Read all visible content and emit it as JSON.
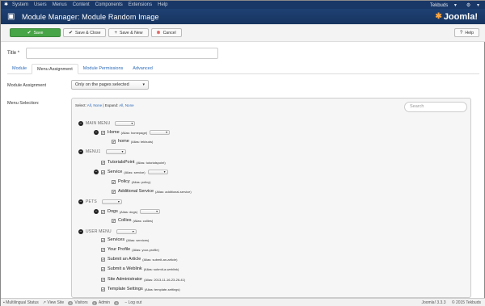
{
  "topnav": {
    "items": [
      "System",
      "Users",
      "Menus",
      "Content",
      "Components",
      "Extensions",
      "Help"
    ],
    "user": "Tekbuds",
    "user_caret": "▾",
    "settings_caret": "▾"
  },
  "header": {
    "title": "Module Manager: Module Random Image",
    "logo": "Joomla!"
  },
  "toolbar": {
    "save": "Save",
    "save_close": "Save & Close",
    "save_new": "Save & New",
    "cancel": "Cancel",
    "help": "Help"
  },
  "form": {
    "title_label": "Title *",
    "title_value": ""
  },
  "tabs": [
    "Module",
    "Menu Assignment",
    "Module Permissions",
    "Advanced"
  ],
  "assignment": {
    "label": "Module Assignment",
    "value": "Only on the pages selected"
  },
  "menu_selection": {
    "label": "Menu Selection:",
    "select_prefix": "Select:",
    "select_all": "All",
    "select_none": "None",
    "expand_prefix": "Expand:",
    "expand_all": "All",
    "expand_none": "None",
    "search_placeholder": "Search"
  },
  "tree": {
    "main_menu": "MAIN MENU",
    "home": "Home",
    "home_alias": "(Alias: homepage)",
    "home2": "home",
    "home2_alias": "(Alias: tekbuds)",
    "menu1": "MENU1",
    "tutorials": "TutorialsPoint",
    "tutorials_alias": "(Alias: tutorialspoint)",
    "service": "Service",
    "service_alias": "(Alias: service)",
    "policy": "Policy",
    "policy_alias": "(Alias: policy)",
    "addl": "Additional Service",
    "addl_alias": "(Alias: additional-service)",
    "pets": "PETS",
    "dogs": "Dogs",
    "dogs_alias": "(Alias: dogs)",
    "collies": "Collies",
    "collies_alias": "(Alias: collies)",
    "user_menu": "USER MENU",
    "services": "Services",
    "services_alias": "(Alias: services)",
    "profile": "Your Profile",
    "profile_alias": "(Alias: your-profile)",
    "article": "Submit an Article",
    "article_alias": "(Alias: submit-an-article)",
    "weblink": "Submit a Weblink",
    "weblink_alias": "(Alias: submit-a-weblink)",
    "siteadmin": "Site Administrator",
    "siteadmin_alias": "(Alias: 2013-11-16-23-26-41)",
    "template": "Template Settings",
    "template_alias": "(Alias: template-settings)"
  },
  "statusbar": {
    "multilingual": "Multilingual Status",
    "view_site": "View Site",
    "visitors_count": "0",
    "visitors": "Visitors",
    "admin_count": "1",
    "admin": "Admin",
    "messages_count": "0",
    "logout": "Log out",
    "version": "Joomla! 3.3.3",
    "copyright": "© 2015 Tekbuds"
  }
}
